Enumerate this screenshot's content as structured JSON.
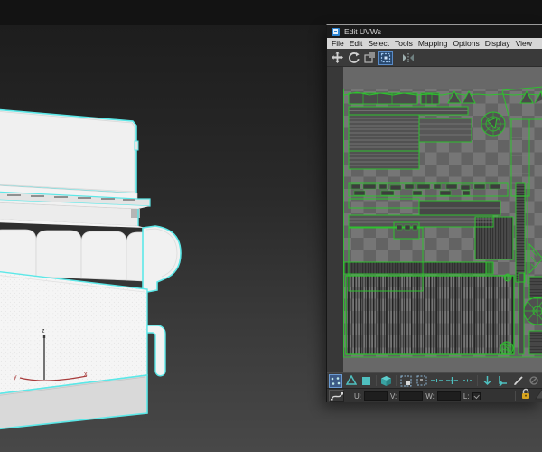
{
  "uvw_window": {
    "title": "Edit UVWs",
    "menus": [
      "File",
      "Edit",
      "Select",
      "Tools",
      "Mapping",
      "Options",
      "Display",
      "View"
    ],
    "toolbar_icons": [
      "move",
      "rotate",
      "scale",
      "freeform-mode",
      "mirror"
    ],
    "selection_icons": [
      "vertex",
      "edge",
      "face",
      "element",
      "grow-selection",
      "shrink-selection",
      "select-edge-loop",
      "select-edge-ring",
      "paint-select",
      "align-h",
      "align-v",
      "relax-brush",
      "loop-disabled",
      "ring-disabled"
    ],
    "transform_row": {
      "soft_selection_icon": "soft-selection-curve",
      "u_label": "U:",
      "u_value": "",
      "v_label": "V:",
      "v_value": "",
      "w_label": "W:",
      "w_value": "",
      "l_label": "L:",
      "l_checked": true,
      "lock_icon": "lock",
      "peel_icon": "quick-peel"
    }
  },
  "viewport": {
    "axis_labels": {
      "x": "x",
      "y": "y",
      "z": "z"
    }
  },
  "colors": {
    "uv_wire_green": "#2ec22e",
    "selection_cyan": "#5ce8e8",
    "teal_icon": "#4fc0c0",
    "checker_light": "#767676",
    "checker_dark": "#636363",
    "title_icon_blue": "#2e86d4",
    "lock_gold": "#d9a520"
  }
}
